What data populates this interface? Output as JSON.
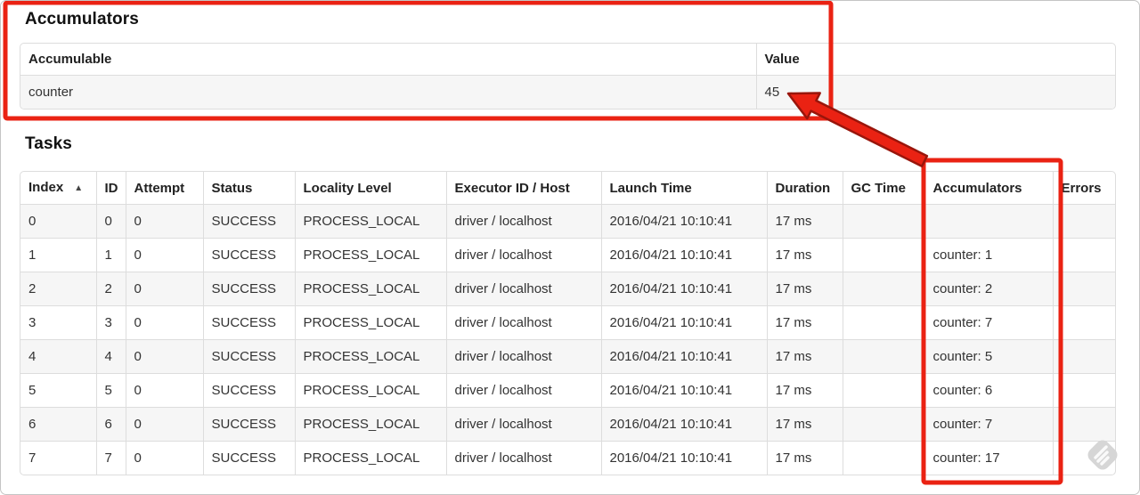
{
  "accumulators": {
    "title": "Accumulators",
    "table": {
      "headers": [
        "Accumulable",
        "Value"
      ],
      "rows": [
        [
          "counter",
          "45"
        ]
      ]
    }
  },
  "tasks": {
    "title": "Tasks",
    "table": {
      "headers": [
        "Index",
        "ID",
        "Attempt",
        "Status",
        "Locality Level",
        "Executor ID / Host",
        "Launch Time",
        "Duration",
        "GC Time",
        "Accumulators",
        "Errors"
      ],
      "sort": {
        "column": "Index",
        "icon": "▲",
        "direction": "ascending"
      },
      "rows": [
        [
          "0",
          "0",
          "0",
          "SUCCESS",
          "PROCESS_LOCAL",
          "driver / localhost",
          "2016/04/21 10:10:41",
          "17 ms",
          "",
          "",
          ""
        ],
        [
          "1",
          "1",
          "0",
          "SUCCESS",
          "PROCESS_LOCAL",
          "driver / localhost",
          "2016/04/21 10:10:41",
          "17 ms",
          "",
          "counter: 1",
          ""
        ],
        [
          "2",
          "2",
          "0",
          "SUCCESS",
          "PROCESS_LOCAL",
          "driver / localhost",
          "2016/04/21 10:10:41",
          "17 ms",
          "",
          "counter: 2",
          ""
        ],
        [
          "3",
          "3",
          "0",
          "SUCCESS",
          "PROCESS_LOCAL",
          "driver / localhost",
          "2016/04/21 10:10:41",
          "17 ms",
          "",
          "counter: 7",
          ""
        ],
        [
          "4",
          "4",
          "0",
          "SUCCESS",
          "PROCESS_LOCAL",
          "driver / localhost",
          "2016/04/21 10:10:41",
          "17 ms",
          "",
          "counter: 5",
          ""
        ],
        [
          "5",
          "5",
          "0",
          "SUCCESS",
          "PROCESS_LOCAL",
          "driver / localhost",
          "2016/04/21 10:10:41",
          "17 ms",
          "",
          "counter: 6",
          ""
        ],
        [
          "6",
          "6",
          "0",
          "SUCCESS",
          "PROCESS_LOCAL",
          "driver / localhost",
          "2016/04/21 10:10:41",
          "17 ms",
          "",
          "counter: 7",
          ""
        ],
        [
          "7",
          "7",
          "0",
          "SUCCESS",
          "PROCESS_LOCAL",
          "driver / localhost",
          "2016/04/21 10:10:41",
          "17 ms",
          "",
          "counter: 17",
          ""
        ]
      ]
    }
  },
  "annotations": {
    "highlight_color": "#ea2213",
    "arrow_outline_color": "#99150b",
    "highlighted_value": "45",
    "highlighted_column": "Accumulators"
  },
  "icons": {
    "sort_ascending": "▲",
    "watermark": "feather-diamond"
  }
}
